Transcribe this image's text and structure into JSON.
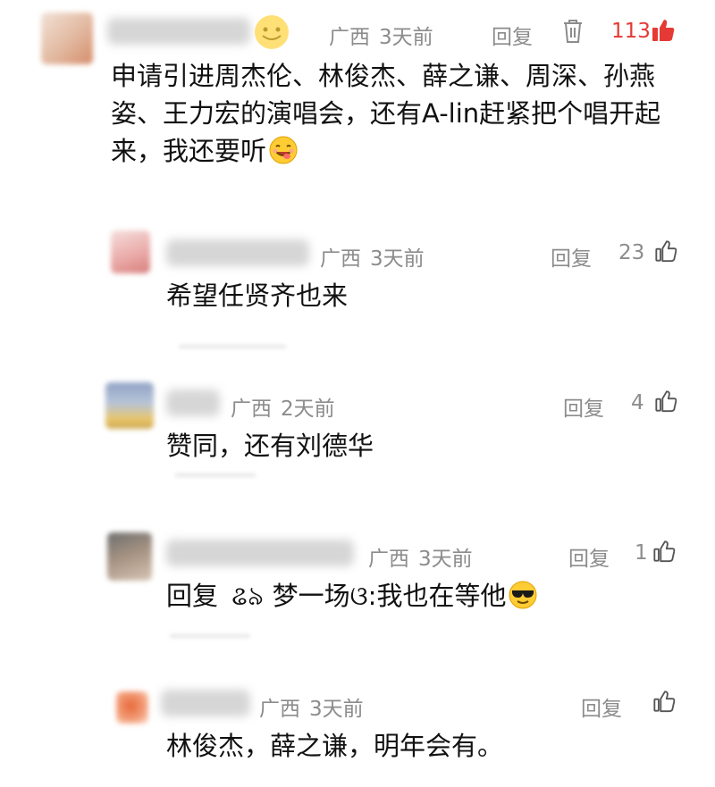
{
  "comments": [
    {
      "location": "广西",
      "time": "3天前",
      "reply_label": "回复",
      "likes": "113",
      "text": "申请引进周杰伦、林俊杰、薛之谦、周深、孙燕姿、王力宏的演唱会，还有A-lin赶紧把个唱开起来，我还要听"
    },
    {
      "location": "广西",
      "time": "3天前",
      "reply_label": "回复",
      "likes": "23",
      "text": "希望任贤齐也来"
    },
    {
      "location": "广西",
      "time": "2天前",
      "reply_label": "回复",
      "likes": "4",
      "text": "赞同，还有刘德华"
    },
    {
      "location": "广西",
      "time": "3天前",
      "reply_label": "回复",
      "likes": "1",
      "text_prefix": "回复",
      "reply_to": "ଌ৯ 梦一场ଓ:",
      "text": "我也在等他"
    },
    {
      "location": "广西",
      "time": "3天前",
      "reply_label": "回复",
      "likes": "",
      "text": "林俊杰，薛之谦，明年会有。"
    }
  ],
  "colors": {
    "hot_like": "#e53935",
    "meta": "#8c8c8c"
  }
}
